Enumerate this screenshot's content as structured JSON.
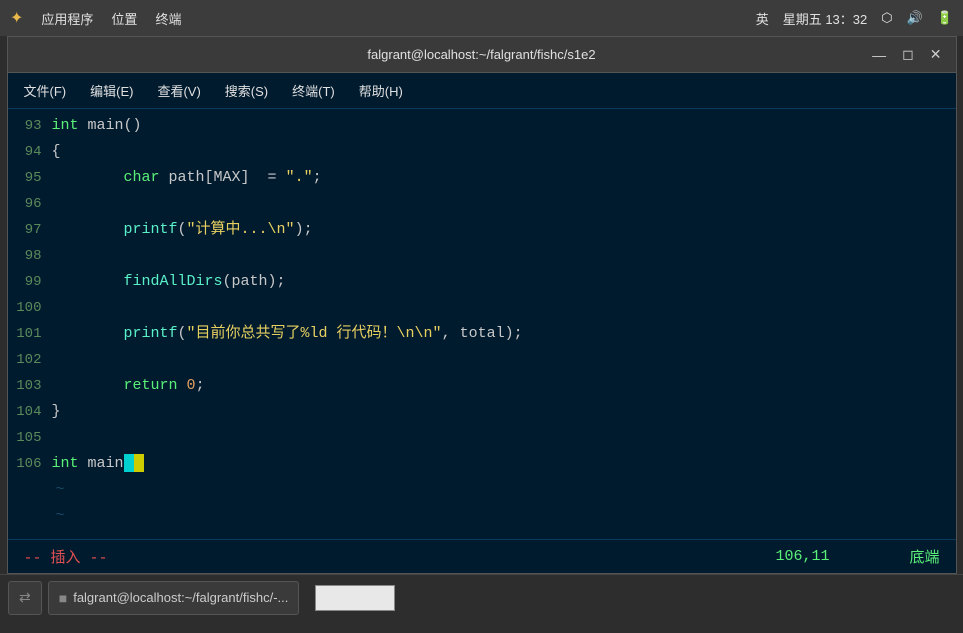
{
  "system_bar": {
    "app_icon": "✦",
    "app_label": "应用程序",
    "loc_label": "位置",
    "term_label": "终端",
    "lang": "英",
    "datetime": "星期五 13：32",
    "net_icon": "net",
    "vol_icon": "vol",
    "bat_icon": "bat"
  },
  "title_bar": {
    "title": "falgrant@localhost:~/falgrant/fishc/s1e2",
    "minimize": "—",
    "maximize": "◻",
    "close": "✕"
  },
  "menu_bar": {
    "items": [
      "文件(F)",
      "编辑(E)",
      "查看(V)",
      "搜索(S)",
      "终端(T)",
      "帮助(H)"
    ]
  },
  "code_lines": [
    {
      "num": "93",
      "content": "int main()"
    },
    {
      "num": "94",
      "content": "{"
    },
    {
      "num": "95",
      "content": "        char path[MAX]  = \".\";"
    },
    {
      "num": "96",
      "content": ""
    },
    {
      "num": "97",
      "content": "        printf(\"计算中...\\n\");"
    },
    {
      "num": "98",
      "content": ""
    },
    {
      "num": "99",
      "content": "        findAllDirs(path);"
    },
    {
      "num": "100",
      "content": ""
    },
    {
      "num": "101",
      "content": "        printf(\"目前你总共写了%ld 行代码！\\n\\n\", total);"
    },
    {
      "num": "102",
      "content": ""
    },
    {
      "num": "103",
      "content": "        return 0;"
    },
    {
      "num": "104",
      "content": "}"
    },
    {
      "num": "105",
      "content": ""
    },
    {
      "num": "106",
      "content": "int main",
      "has_cursor": true
    },
    {
      "num": "",
      "content": "~",
      "is_tilde": true
    },
    {
      "num": "",
      "content": "~",
      "is_tilde": true
    }
  ],
  "status_bar": {
    "mode": "-- 插入 --",
    "position": "106,11",
    "location": "底端"
  },
  "taskbar": {
    "switch_icon": "⇄",
    "terminal_label": "falgrant@localhost:~/falgrant/fishc/-..."
  }
}
